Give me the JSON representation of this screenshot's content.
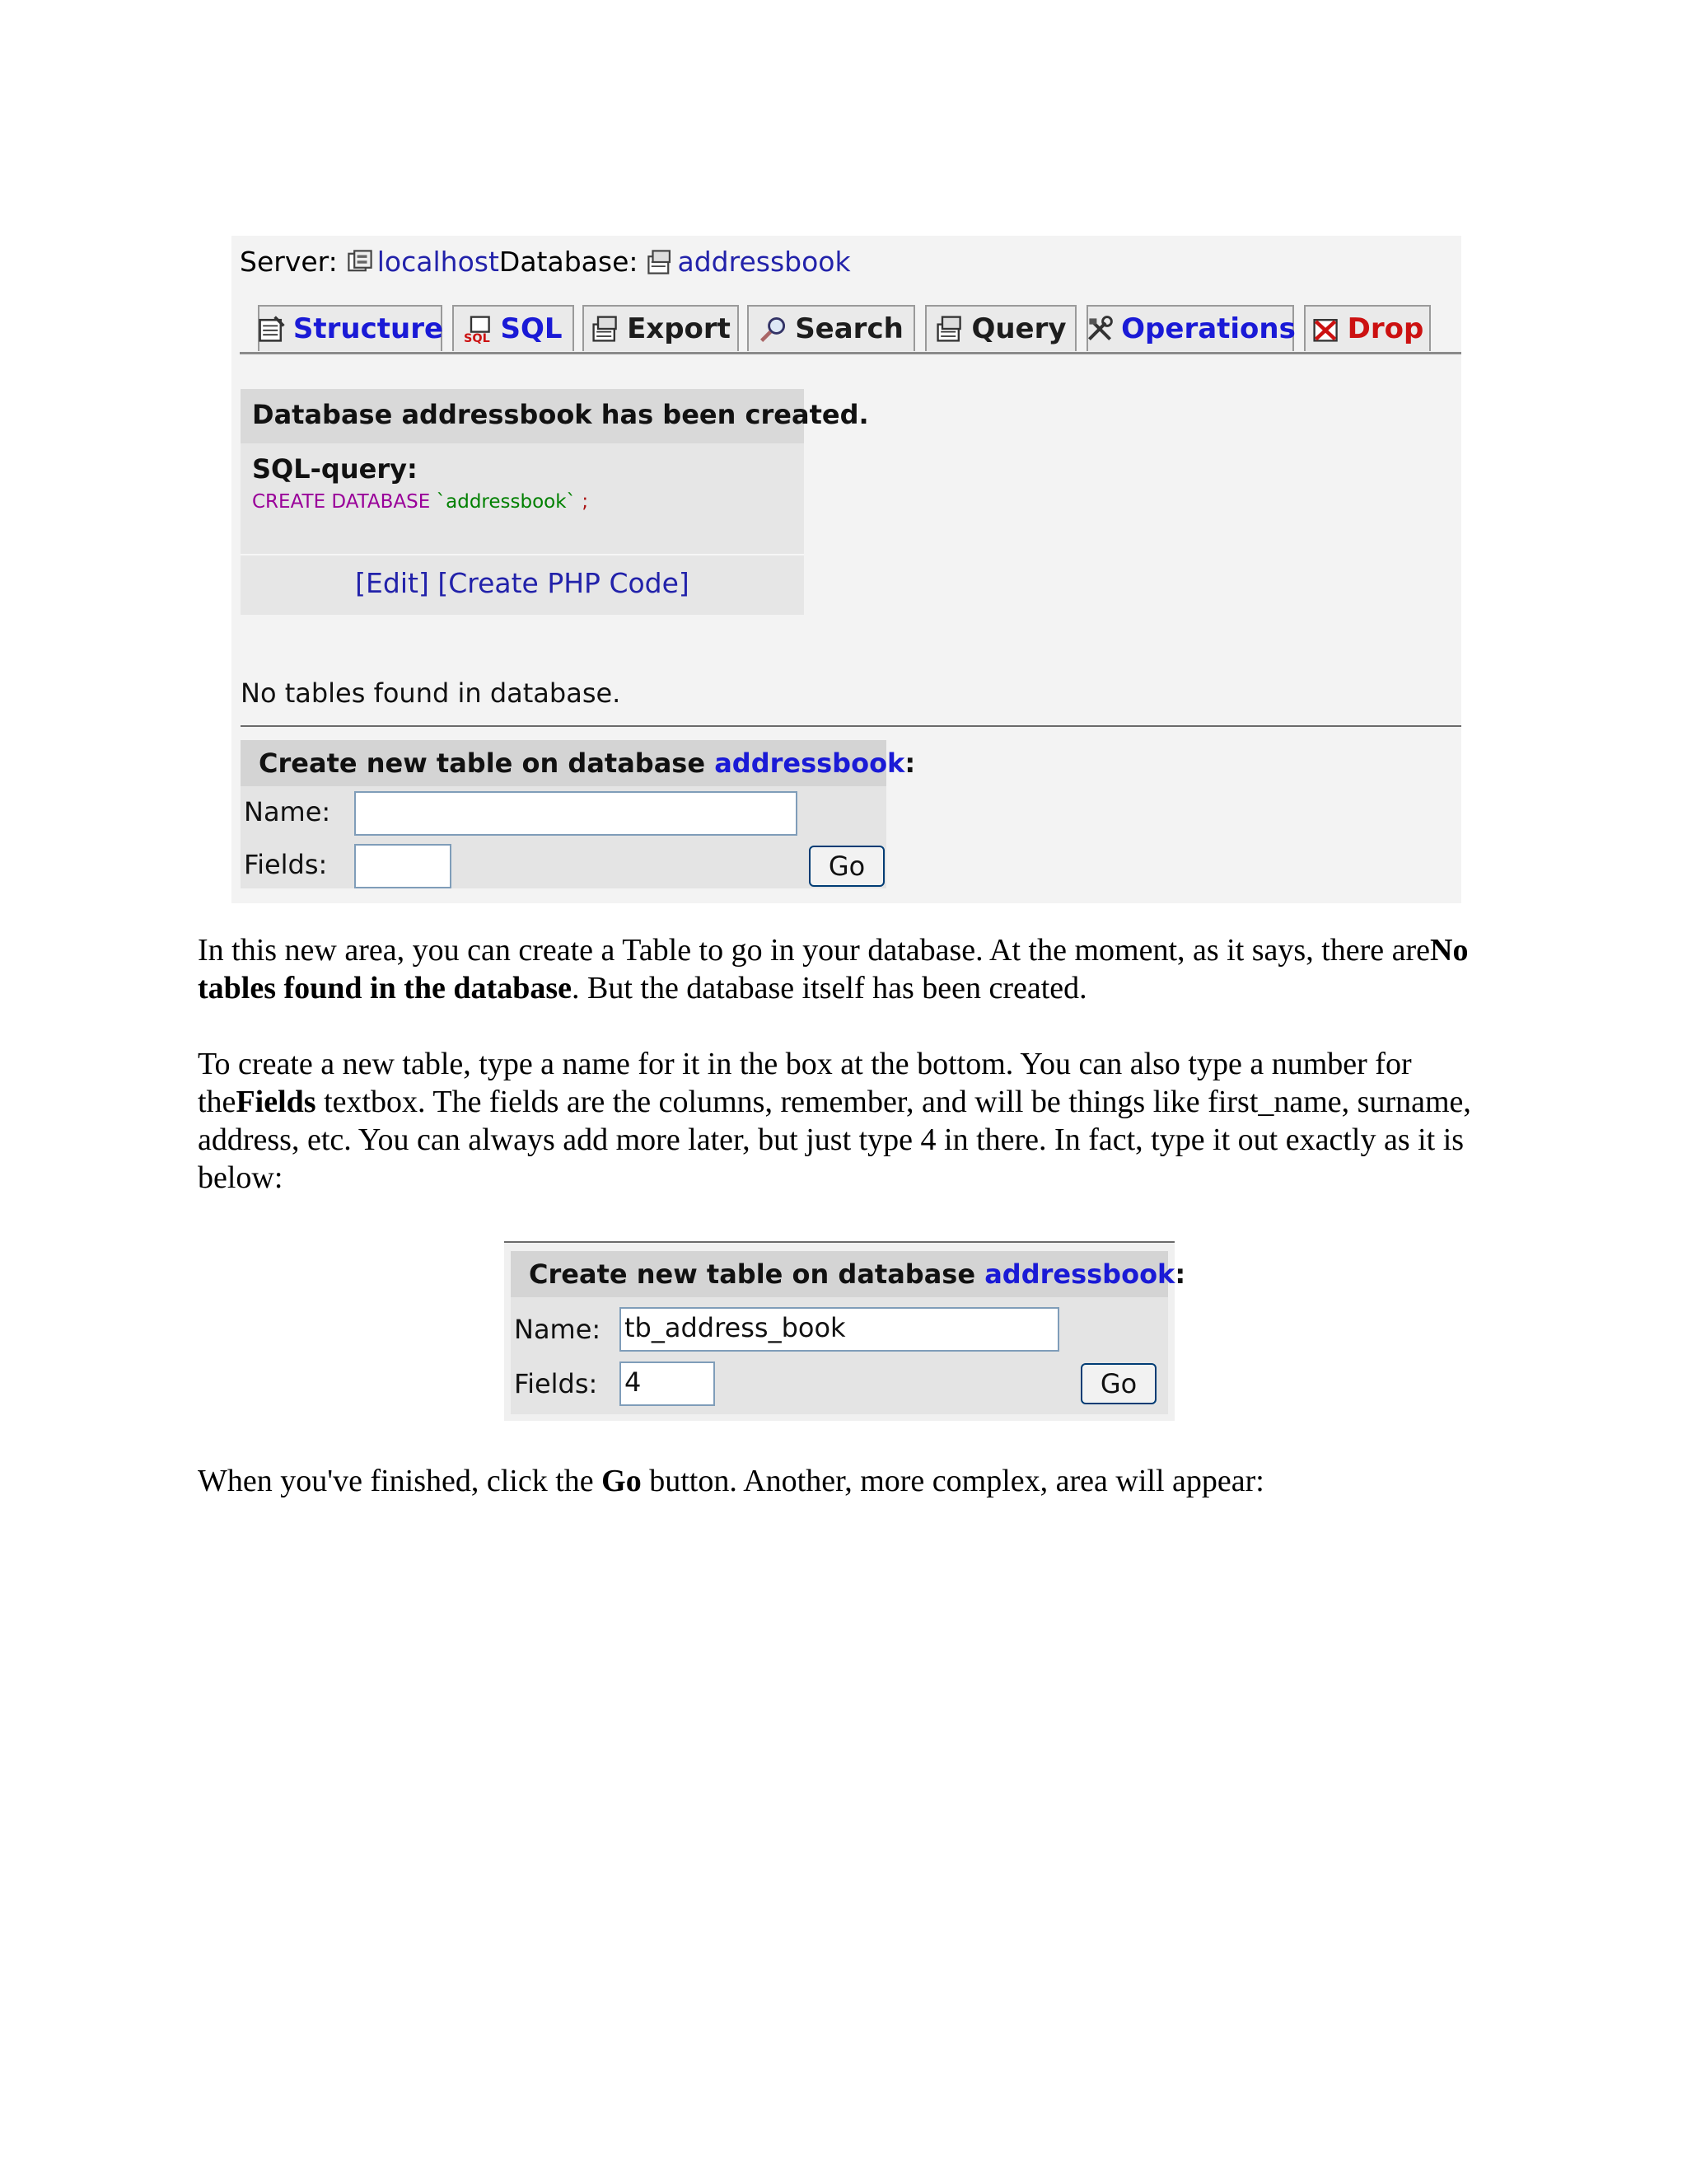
{
  "server_bar": {
    "server_label": "Server:",
    "server_name": "localhost",
    "database_label": "Database:",
    "database_name": "addressbook"
  },
  "tabs": [
    {
      "label": "Structure",
      "icon": "structure-icon",
      "color": "#1a1ad6"
    },
    {
      "label": "SQL",
      "icon": "sql-icon",
      "color": "#1a1ad6"
    },
    {
      "label": "Export",
      "icon": "export-icon",
      "color": "#1d1d1d"
    },
    {
      "label": "Search",
      "icon": "search-icon",
      "color": "#1d1d1d"
    },
    {
      "label": "Query",
      "icon": "query-icon",
      "color": "#1d1d1d"
    },
    {
      "label": "Operations",
      "icon": "operations-icon",
      "color": "#1a1ad6"
    },
    {
      "label": "Drop",
      "icon": "drop-icon",
      "color": "#cc1111"
    }
  ],
  "message": {
    "header": "Database addressbook has been created.",
    "sql_label": "SQL-query:",
    "sql_keyword": "CREATE DATABASE",
    "sql_name": "`addressbook`",
    "sql_end": ";",
    "links": [
      "[Edit]",
      "[Create PHP Code]"
    ]
  },
  "no_tables": "No tables found in database.",
  "form1": {
    "header_prefix": "Create new table on database",
    "database_link": "addressbook",
    "header_suffix": ":",
    "name_label": "Name:",
    "name_value": "",
    "fields_label": "Fields:",
    "fields_value": "",
    "go_label": "Go"
  },
  "paragraph1": {
    "text1": "In this new area, you can create a Table to go in your database. At the moment, as it says, there are",
    "bold1": "No tables found in the database",
    "text2": ". But the database itself has been created."
  },
  "paragraph2": {
    "text1": "To create a new table, type a name for it in the box at the bottom. You can also type a number for the",
    "bold1": "Fields",
    "text2": " textbox. The fields are the columns, remember, and will be things like first_name, surname, address, etc. You can always add more later, but just type 4 in there. In fact, type it out exactly as it is below:"
  },
  "form2": {
    "header_prefix": "Create new table on database",
    "database_link": "addressbook",
    "header_suffix": ":",
    "name_label": "Name:",
    "name_value": "tb_address_book",
    "fields_label": "Fields:",
    "fields_value": "4",
    "go_label": "Go"
  },
  "paragraph3": {
    "text1": "When you've finished, click the ",
    "bold1": "Go",
    "text2": " button. Another, more complex, area will appear:"
  }
}
